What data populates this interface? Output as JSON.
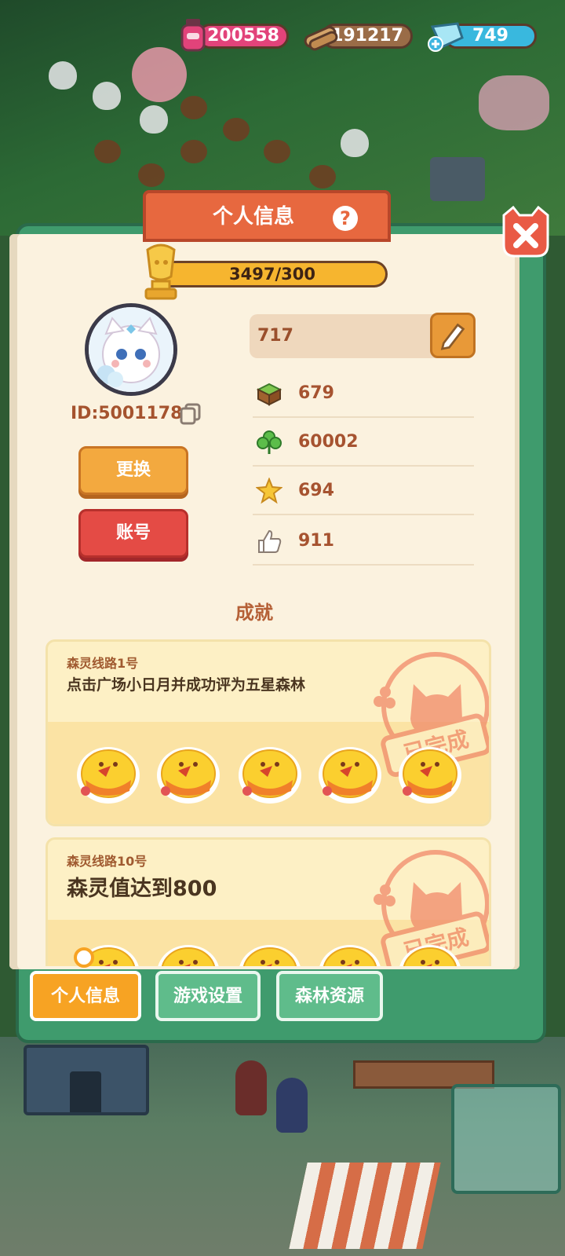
{
  "resources": {
    "ink": "200558",
    "wood": "191217",
    "gems": "749"
  },
  "panel": {
    "title": "个人信息",
    "help_icon": "question-icon",
    "close_icon": "close-icon"
  },
  "profile": {
    "progress_text": "3497/300",
    "progress_fraction": 1.0,
    "id_text": "ID:5001178",
    "change_label": "更换",
    "account_label": "账号",
    "name_value": "717"
  },
  "stats": [
    {
      "icon": "grass-block-icon",
      "value": "679"
    },
    {
      "icon": "clover-icon",
      "value": "60002"
    },
    {
      "icon": "star-icon",
      "value": "694"
    },
    {
      "icon": "thumbs-up-icon",
      "value": "911"
    }
  ],
  "achievements": {
    "title": "成就",
    "items": [
      {
        "route": "森灵线路1号",
        "desc": "点击广场小日月并成功评为五星森林",
        "status": "已完成"
      },
      {
        "route": "森灵线路10号",
        "desc": "森灵值达到800",
        "status": "已完成"
      }
    ]
  },
  "tabs": [
    {
      "label": "个人信息",
      "active": true
    },
    {
      "label": "游戏设置",
      "active": false
    },
    {
      "label": "森林资源",
      "active": false
    }
  ],
  "colors": {
    "accent": "#f7a323",
    "panel_green": "#3f9b6d",
    "title_orange": "#e7683f",
    "stamp": "#f08a6a"
  }
}
